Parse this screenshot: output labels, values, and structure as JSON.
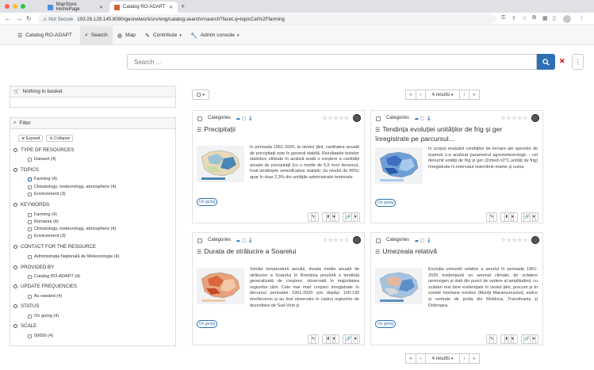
{
  "browser": {
    "tabs": [
      {
        "label": "MapStore HomePage",
        "active": false
      },
      {
        "label": "Catalog RO-ADAPT",
        "active": true
      }
    ],
    "not_secure_label": "Not Secure",
    "url": "193.26.129.145:8080/geonetwork/srv/eng/catalog.search#/search?facet.q=topicCat%2Ffarming"
  },
  "appnav": {
    "brand": "Catalog RO-ADAPT",
    "items": [
      "Search",
      "Map",
      "Contribute",
      "Admin console"
    ]
  },
  "search": {
    "placeholder": "Search ..."
  },
  "basket": {
    "label": "Nothing in basket"
  },
  "filter": {
    "title": "Filter",
    "expand": "Expand",
    "collapse": "Collapse",
    "groups": [
      {
        "label": "TYPE OF RESOURCES",
        "items": [
          {
            "label": "Dataset (4)",
            "checked": false
          }
        ]
      },
      {
        "label": "TOPICS",
        "items": [
          {
            "label": "Farming (4)",
            "checked": true
          },
          {
            "label": "Climatology, meteorology, atmosphere (4)",
            "checked": false
          },
          {
            "label": "Environment (3)",
            "checked": false
          }
        ]
      },
      {
        "label": "KEYWORDS",
        "items": [
          {
            "label": "Farming (4)",
            "checked": false
          },
          {
            "label": "Romania (4)",
            "checked": false
          },
          {
            "label": "Climatology, meteorology, atmosphere (4)",
            "checked": false
          },
          {
            "label": "Environment (3)",
            "checked": false
          }
        ]
      },
      {
        "label": "CONTACT FOR THE RESOURCE",
        "items": [
          {
            "label": "Administrația Națională de Meteorologie (4)",
            "checked": false
          }
        ]
      },
      {
        "label": "PROVIDED BY",
        "items": [
          {
            "label": "Catalog RO-ADAPT (4)",
            "checked": false
          }
        ]
      },
      {
        "label": "UPDATE FREQUENCIES",
        "items": [
          {
            "label": "As needed (4)",
            "checked": false
          }
        ]
      },
      {
        "label": "STATUS",
        "items": [
          {
            "label": "On going (4)",
            "checked": false
          }
        ]
      },
      {
        "label": "SCALE",
        "items": [
          {
            "label": "50000 (4)",
            "checked": false
          }
        ]
      }
    ]
  },
  "results": {
    "count_label": "4 results"
  },
  "cards": [
    {
      "categories_label": "Categories",
      "title": "Precipitații",
      "abstract": "În perioada 1961-2020, la nivelul țării, cantitatea anuală de precipitații este în general stabilă. Rezultatele testelor statistice utilizate în analiză arată o creștere a cantității anuale de precipitații (cu o medie de 5,5 mm/ deceniu), însă tendințele semnificative statistic (la nivelul de 95%) apar în doar 2,3% din unitățile administrativ teritoriale",
      "status": "On going",
      "colors": [
        "#e8d9b8",
        "#9cc3d5",
        "#4a86b5",
        "#c9dba6"
      ]
    },
    {
      "categories_label": "Categories",
      "title": "Tendința evoluției unităților de frig și ger înregistrate pe parcursul...",
      "abstract": "În scopul evaluării condițiilor de iernare ale speciilor de toamnă s-a analizat parametrul agrometeorologic - cel denumit unități de frig și ger (Σtmed.<0°C,unități de frig) înregistrate în intervalul noiembrie-martie și suma",
      "status": "On going",
      "colors": [
        "#6f9fd8",
        "#3c6fc0",
        "#aac8ec",
        "#2b58a8"
      ]
    },
    {
      "categories_label": "Categories",
      "title": "Durata de strălucire a Soarelui",
      "abstract": "Similar temperaturii aerului, durata medie anuală de strălucire a Soarelui în România prezintă o tendință generalizată de creștere, observată în majoritatea regiunilor țării. Cele mai mari creșteri înregistrate în decursul perioadei 1961-2020 pot depăși 100-130 ore/deceniu și au fost observate în cadrul regiunilor de dezvoltare de Sud-Vest și",
      "status": "On going",
      "colors": [
        "#e7a27a",
        "#d9663c",
        "#f3c9a8",
        "#c5482a"
      ]
    },
    {
      "categories_label": "Categories",
      "title": "Umezeala relativă",
      "abstract": "Evoluția umezelii relative a aerului în perioada 1961-2020 evidențiază un semnal climatic de scădere neomogen și slab din punct de vedere al amplitudinii, cu scăderi mai bine evidențiate în vestul țării, precum și în zonele montane nordice (Munții Maramureșului), estice și centrale de podiș din Moldova, Transilvania și Dobrogea.",
      "status": "On going",
      "colors": [
        "#a3c3e3",
        "#e4b7a0",
        "#5d8fc6",
        "#d9d9d9"
      ]
    }
  ]
}
